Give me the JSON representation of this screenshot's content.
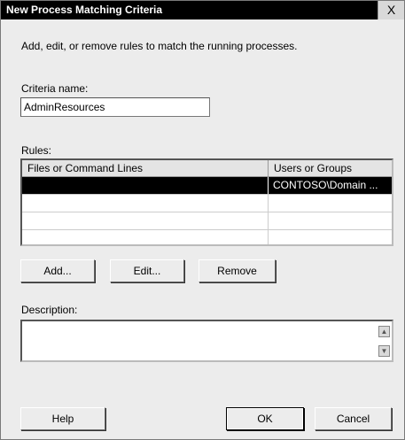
{
  "window": {
    "title": "New Process Matching Criteria",
    "close_label": "X"
  },
  "intro_text": "Add, edit, or remove rules to match the running processes.",
  "criteria": {
    "label": "Criteria name:",
    "value": "AdminResources"
  },
  "rules": {
    "label": "Rules:",
    "columns": [
      "Files or Command Lines",
      "Users or Groups"
    ],
    "rows": [
      {
        "files": "",
        "users": "CONTOSO\\Domain ...",
        "selected": true
      },
      {
        "files": "",
        "users": ""
      },
      {
        "files": "",
        "users": ""
      },
      {
        "files": "",
        "users": ""
      }
    ]
  },
  "buttons": {
    "add": "Add...",
    "edit": "Edit...",
    "remove": "Remove",
    "help": "Help",
    "ok": "OK",
    "cancel": "Cancel"
  },
  "description": {
    "label": "Description:",
    "value": ""
  },
  "scrollbar": {
    "up_icon": "▲",
    "down_icon": "▼"
  }
}
